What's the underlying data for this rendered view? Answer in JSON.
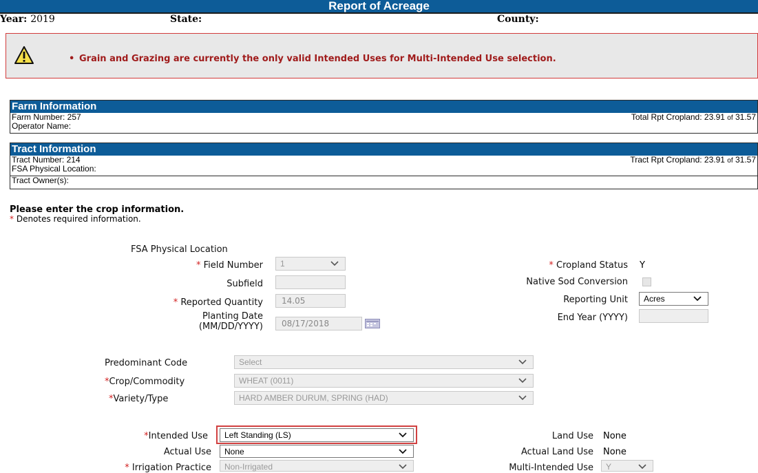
{
  "title": "Report of Acreage",
  "header": {
    "year_label": "Year:",
    "year_value": "2019",
    "state_label": "State:",
    "county_label": "County:"
  },
  "alert": {
    "message": "Grain and Grazing are currently the only valid Intended Uses for Multi-Intended Use selection."
  },
  "farm": {
    "heading": "Farm Information",
    "farm_number": "Farm Number: 257",
    "operator_name": "Operator Name:",
    "total_rpt_label": "Total Rpt Cropland: 23.91",
    "total_rpt_of": "of",
    "total_rpt_total": "31.57"
  },
  "tract": {
    "heading": "Tract Information",
    "tract_number": "Tract Number: 214",
    "physical_location": "FSA Physical Location:",
    "owners": "Tract Owner(s):",
    "tract_rpt_label": "Tract Rpt Cropland: 23.91",
    "tract_rpt_of": "of",
    "tract_rpt_total": "31.57"
  },
  "instructions": {
    "main": "Please enter the crop information.",
    "required_note": "Denotes required information.",
    "asterisk": "*"
  },
  "form": {
    "fsa_physical_location": "FSA Physical Location",
    "field_number_label": "Field Number",
    "field_number_value": "1",
    "subfield_label": "Subfield",
    "subfield_value": "",
    "reported_quantity_label": "Reported Quantity",
    "reported_quantity_value": "14.05",
    "planting_date_label_1": "Planting Date",
    "planting_date_label_2": "(MM/DD/YYYY)",
    "planting_date_value": "08/17/2018",
    "cropland_status_label": "Cropland Status",
    "cropland_status_value": "Y",
    "native_sod_label": "Native Sod Conversion",
    "reporting_unit_label": "Reporting Unit",
    "reporting_unit_value": "Acres",
    "end_year_label": "End Year (YYYY)",
    "end_year_value": "",
    "predominant_code_label": "Predominant Code",
    "predominant_code_value": "Select",
    "crop_commodity_label": "Crop/Commodity",
    "crop_commodity_value": "WHEAT (0011)",
    "variety_type_label": "Variety/Type",
    "variety_type_value": "HARD AMBER DURUM, SPRING (HAD)",
    "intended_use_label": "Intended Use",
    "intended_use_value": "Left Standing (LS)",
    "actual_use_label": "Actual Use",
    "actual_use_value": "None",
    "irrigation_label": "Irrigation Practice",
    "irrigation_value": "Non-Irrigated",
    "land_use_label": "Land Use",
    "land_use_value": "None",
    "actual_land_use_label": "Actual Land Use",
    "actual_land_use_value": "None",
    "multi_intended_use_label": "Multi-Intended Use",
    "multi_intended_use_value": "Y"
  },
  "colors": {
    "header_blue": "#0d5c98",
    "alert_red": "#a01c1c",
    "required_red": "#d21f1f"
  }
}
